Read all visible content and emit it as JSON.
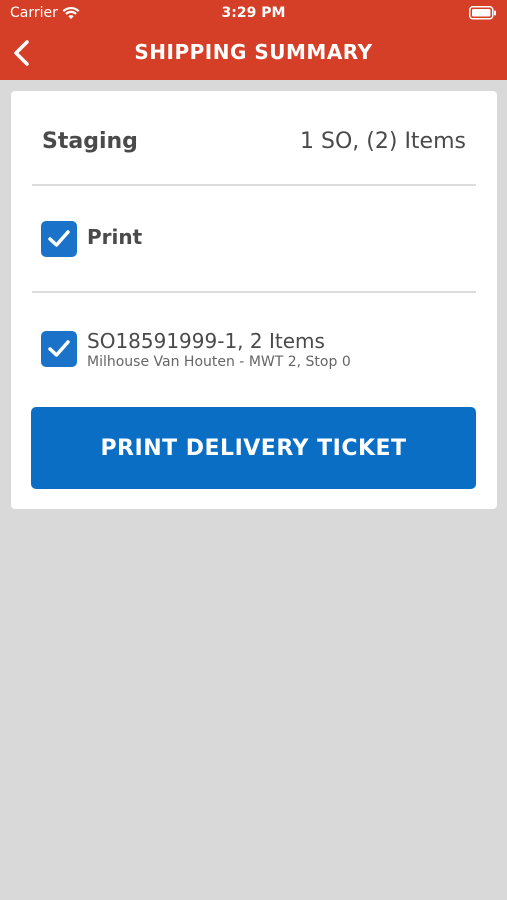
{
  "status_bar": {
    "carrier": "Carrier",
    "time": "3:29 PM",
    "icons": [
      "wifi-icon",
      "battery-icon"
    ]
  },
  "nav": {
    "title": "SHIPPING SUMMARY",
    "back_icon": "chevron-left-icon",
    "color": "#d63f27"
  },
  "staging": {
    "label": "Staging",
    "count": "1 SO, (2) Items"
  },
  "print_option": {
    "label": "Print",
    "checked": true
  },
  "order": {
    "title": "SO18591999-1, 2 Items",
    "subtitle": "Milhouse Van Houten - MWT 2, Stop 0",
    "checked": true
  },
  "action": {
    "button_label": "PRINT DELIVERY TICKET",
    "color": "#0a6fc4"
  }
}
